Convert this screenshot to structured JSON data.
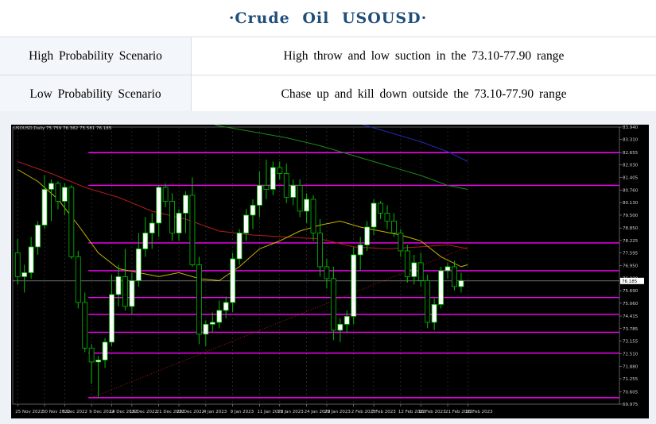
{
  "title": "·Crude  Oil  USOUSD·",
  "scenarios": [
    {
      "label": "High Probability Scenario",
      "value": "High throw and low suction in the 73.10-77.90 range"
    },
    {
      "label": "Low Probability Scenario",
      "value": "Chase up and kill down outside the 73.10-77.90 range"
    }
  ],
  "chart_header": "USOUSD,Daily  75.759 76.362 75.581 76.185",
  "colors": {
    "background": "#000000",
    "bull": "#ffffff",
    "bear": "#000000",
    "wick": "#00c000",
    "level_line": "#ff00ff",
    "ma_fast": "#c8b400",
    "ma_mid": "#b21d1d",
    "ma_slow": "#1a8a1a",
    "ma_long": "#1e2cb4",
    "trend_dotted": "#b21d1d",
    "current_price": "#b0b0b0"
  },
  "chart_data": {
    "type": "candlestick",
    "title": "",
    "symbol": "USOUSD",
    "timeframe": "Daily",
    "header_values": {
      "open": 75.759,
      "high": 76.362,
      "low": 75.581,
      "close": 76.185
    },
    "ylim": [
      69.975,
      83.94
    ],
    "yticks": [
      83.94,
      83.31,
      82.655,
      82.03,
      81.405,
      80.76,
      80.13,
      79.5,
      78.85,
      78.225,
      77.595,
      76.95,
      76.32,
      75.69,
      75.06,
      74.415,
      73.785,
      73.155,
      72.51,
      71.88,
      71.255,
      70.605,
      69.975
    ],
    "current_price": 76.185,
    "xticks": [
      {
        "label": "25 Nov 2022",
        "index": 0
      },
      {
        "label": "30 Nov 2022",
        "index": 4
      },
      {
        "label": "5 Dec 2022",
        "index": 7
      },
      {
        "label": "9 Dec 2022",
        "index": 11
      },
      {
        "label": "14 Dec 2022",
        "index": 14
      },
      {
        "label": "19 Dec 2022",
        "index": 17
      },
      {
        "label": "21 Dec 2022",
        "index": 21
      },
      {
        "label": "29 Dec 2022",
        "index": 24
      },
      {
        "label": "4 Jan 2023",
        "index": 28
      },
      {
        "label": "9 Jan 2023",
        "index": 32
      },
      {
        "label": "11 Jan 2023",
        "index": 36
      },
      {
        "label": "19 Jan 2023",
        "index": 39
      },
      {
        "label": "24 Jan 2023",
        "index": 43
      },
      {
        "label": "29 Jan 2023",
        "index": 46
      },
      {
        "label": "2 Feb 2023",
        "index": 50
      },
      {
        "label": "7 Feb 2023",
        "index": 53
      },
      {
        "label": "12 Feb 2023",
        "index": 57
      },
      {
        "label": "16 Feb 2023",
        "index": 60
      },
      {
        "label": "21 Feb 2023",
        "index": 64
      },
      {
        "label": "26 Feb 2023",
        "index": 67
      }
    ],
    "levels": [
      82.65,
      81.0,
      78.1,
      76.7,
      75.35,
      74.5,
      73.6,
      72.55,
      70.3
    ],
    "candles": [
      {
        "o": 77.6,
        "h": 78.3,
        "l": 76.0,
        "c": 76.4
      },
      {
        "o": 76.4,
        "h": 77.0,
        "l": 75.6,
        "c": 76.6
      },
      {
        "o": 76.6,
        "h": 78.4,
        "l": 76.3,
        "c": 77.9
      },
      {
        "o": 77.9,
        "h": 79.2,
        "l": 77.5,
        "c": 79.0
      },
      {
        "o": 79.0,
        "h": 81.5,
        "l": 78.8,
        "c": 80.8
      },
      {
        "o": 80.8,
        "h": 81.3,
        "l": 79.2,
        "c": 81.1
      },
      {
        "o": 81.1,
        "h": 81.2,
        "l": 79.8,
        "c": 80.2
      },
      {
        "o": 80.2,
        "h": 81.1,
        "l": 79.5,
        "c": 80.9
      },
      {
        "o": 80.9,
        "h": 81.0,
        "l": 77.3,
        "c": 77.4
      },
      {
        "o": 77.4,
        "h": 77.7,
        "l": 74.8,
        "c": 75.1
      },
      {
        "o": 75.1,
        "h": 75.6,
        "l": 72.6,
        "c": 72.8
      },
      {
        "o": 72.8,
        "h": 73.0,
        "l": 71.0,
        "c": 72.1
      },
      {
        "o": 72.1,
        "h": 72.4,
        "l": 70.3,
        "c": 72.2
      },
      {
        "o": 72.2,
        "h": 73.3,
        "l": 71.8,
        "c": 73.1
      },
      {
        "o": 73.1,
        "h": 76.5,
        "l": 72.9,
        "c": 75.5
      },
      {
        "o": 75.5,
        "h": 77.0,
        "l": 74.9,
        "c": 76.4
      },
      {
        "o": 76.4,
        "h": 77.8,
        "l": 74.7,
        "c": 74.9
      },
      {
        "o": 74.9,
        "h": 76.6,
        "l": 74.5,
        "c": 76.2
      },
      {
        "o": 76.2,
        "h": 78.6,
        "l": 75.9,
        "c": 77.8
      },
      {
        "o": 77.8,
        "h": 79.4,
        "l": 77.4,
        "c": 78.6
      },
      {
        "o": 78.6,
        "h": 79.6,
        "l": 77.8,
        "c": 79.1
      },
      {
        "o": 79.1,
        "h": 81.0,
        "l": 78.4,
        "c": 80.9
      },
      {
        "o": 80.9,
        "h": 81.1,
        "l": 79.9,
        "c": 80.2
      },
      {
        "o": 80.2,
        "h": 80.6,
        "l": 78.2,
        "c": 78.6
      },
      {
        "o": 78.6,
        "h": 79.8,
        "l": 78.2,
        "c": 79.6
      },
      {
        "o": 79.6,
        "h": 80.7,
        "l": 78.6,
        "c": 80.5
      },
      {
        "o": 80.5,
        "h": 81.4,
        "l": 76.9,
        "c": 77.0
      },
      {
        "o": 77.0,
        "h": 77.4,
        "l": 73.0,
        "c": 73.5
      },
      {
        "o": 73.5,
        "h": 74.2,
        "l": 72.9,
        "c": 74.0
      },
      {
        "o": 74.0,
        "h": 74.6,
        "l": 73.6,
        "c": 74.1
      },
      {
        "o": 74.1,
        "h": 75.2,
        "l": 73.8,
        "c": 74.7
      },
      {
        "o": 74.7,
        "h": 75.4,
        "l": 74.3,
        "c": 75.1
      },
      {
        "o": 75.1,
        "h": 77.6,
        "l": 74.6,
        "c": 77.3
      },
      {
        "o": 77.3,
        "h": 78.8,
        "l": 77.0,
        "c": 78.6
      },
      {
        "o": 78.6,
        "h": 79.8,
        "l": 78.2,
        "c": 79.5
      },
      {
        "o": 79.5,
        "h": 80.3,
        "l": 78.8,
        "c": 80.0
      },
      {
        "o": 80.0,
        "h": 81.7,
        "l": 79.4,
        "c": 81.0
      },
      {
        "o": 81.0,
        "h": 82.3,
        "l": 80.3,
        "c": 80.8
      },
      {
        "o": 80.8,
        "h": 82.2,
        "l": 80.5,
        "c": 81.9
      },
      {
        "o": 81.9,
        "h": 82.2,
        "l": 81.3,
        "c": 81.6
      },
      {
        "o": 81.6,
        "h": 82.1,
        "l": 80.1,
        "c": 80.4
      },
      {
        "o": 80.4,
        "h": 81.3,
        "l": 80.0,
        "c": 81.0
      },
      {
        "o": 81.0,
        "h": 81.3,
        "l": 79.4,
        "c": 79.7
      },
      {
        "o": 79.7,
        "h": 80.6,
        "l": 79.1,
        "c": 80.3
      },
      {
        "o": 80.3,
        "h": 80.5,
        "l": 78.2,
        "c": 78.6
      },
      {
        "o": 78.6,
        "h": 79.3,
        "l": 76.4,
        "c": 76.9
      },
      {
        "o": 76.9,
        "h": 77.3,
        "l": 75.8,
        "c": 76.3
      },
      {
        "o": 76.3,
        "h": 76.9,
        "l": 73.2,
        "c": 73.7
      },
      {
        "o": 73.7,
        "h": 74.3,
        "l": 73.1,
        "c": 74.0
      },
      {
        "o": 74.0,
        "h": 74.7,
        "l": 73.6,
        "c": 74.4
      },
      {
        "o": 74.4,
        "h": 77.9,
        "l": 74.0,
        "c": 77.5
      },
      {
        "o": 77.5,
        "h": 78.4,
        "l": 76.7,
        "c": 78.0
      },
      {
        "o": 78.0,
        "h": 79.2,
        "l": 77.7,
        "c": 78.9
      },
      {
        "o": 78.9,
        "h": 80.3,
        "l": 78.5,
        "c": 80.1
      },
      {
        "o": 80.1,
        "h": 80.2,
        "l": 79.3,
        "c": 79.6
      },
      {
        "o": 79.6,
        "h": 80.0,
        "l": 78.8,
        "c": 79.2
      },
      {
        "o": 79.2,
        "h": 79.6,
        "l": 78.4,
        "c": 78.6
      },
      {
        "o": 78.6,
        "h": 78.8,
        "l": 77.4,
        "c": 77.7
      },
      {
        "o": 77.7,
        "h": 78.0,
        "l": 76.1,
        "c": 76.4
      },
      {
        "o": 76.4,
        "h": 77.5,
        "l": 76.0,
        "c": 77.1
      },
      {
        "o": 77.1,
        "h": 77.6,
        "l": 75.9,
        "c": 76.2
      },
      {
        "o": 76.2,
        "h": 76.5,
        "l": 73.8,
        "c": 74.1
      },
      {
        "o": 74.1,
        "h": 75.3,
        "l": 73.7,
        "c": 75.0
      },
      {
        "o": 75.0,
        "h": 76.9,
        "l": 74.8,
        "c": 76.7
      },
      {
        "o": 76.7,
        "h": 77.1,
        "l": 76.3,
        "c": 76.9
      },
      {
        "o": 76.9,
        "h": 77.2,
        "l": 75.7,
        "c": 75.9
      },
      {
        "o": 75.9,
        "h": 76.6,
        "l": 75.6,
        "c": 76.2
      }
    ],
    "ma_fast": [
      [
        0,
        81.8
      ],
      [
        3,
        81.2
      ],
      [
        6,
        80.3
      ],
      [
        9,
        79.0
      ],
      [
        12,
        77.6
      ],
      [
        15,
        76.8
      ],
      [
        18,
        76.6
      ],
      [
        21,
        76.4
      ],
      [
        24,
        76.6
      ],
      [
        27,
        76.3
      ],
      [
        30,
        76.2
      ],
      [
        33,
        76.9
      ],
      [
        36,
        77.8
      ],
      [
        39,
        78.2
      ],
      [
        42,
        78.7
      ],
      [
        45,
        79.0
      ],
      [
        48,
        79.2
      ],
      [
        51,
        78.9
      ],
      [
        54,
        78.7
      ],
      [
        57,
        78.5
      ],
      [
        60,
        78.2
      ],
      [
        63,
        77.4
      ],
      [
        66,
        76.9
      ],
      [
        67,
        77.0
      ]
    ],
    "ma_mid": [
      [
        0,
        82.2
      ],
      [
        5,
        81.6
      ],
      [
        10,
        80.9
      ],
      [
        15,
        80.4
      ],
      [
        20,
        79.7
      ],
      [
        25,
        79.3
      ],
      [
        30,
        78.7
      ],
      [
        35,
        78.5
      ],
      [
        40,
        78.4
      ],
      [
        45,
        78.3
      ],
      [
        50,
        77.9
      ],
      [
        55,
        77.8
      ],
      [
        60,
        77.9
      ],
      [
        64,
        78.0
      ],
      [
        67,
        77.8
      ]
    ],
    "ma_slow": [
      [
        25,
        84.5
      ],
      [
        30,
        84.0
      ],
      [
        35,
        83.7
      ],
      [
        40,
        83.4
      ],
      [
        45,
        83.0
      ],
      [
        50,
        82.5
      ],
      [
        55,
        82.0
      ],
      [
        60,
        81.5
      ],
      [
        64,
        81.0
      ],
      [
        67,
        80.8
      ]
    ],
    "ma_long": [
      [
        50,
        84.2
      ],
      [
        55,
        83.7
      ],
      [
        60,
        83.2
      ],
      [
        64,
        82.7
      ],
      [
        67,
        82.2
      ]
    ],
    "trend_dotted": [
      [
        11,
        70.3
      ],
      [
        67,
        77.9
      ]
    ]
  }
}
